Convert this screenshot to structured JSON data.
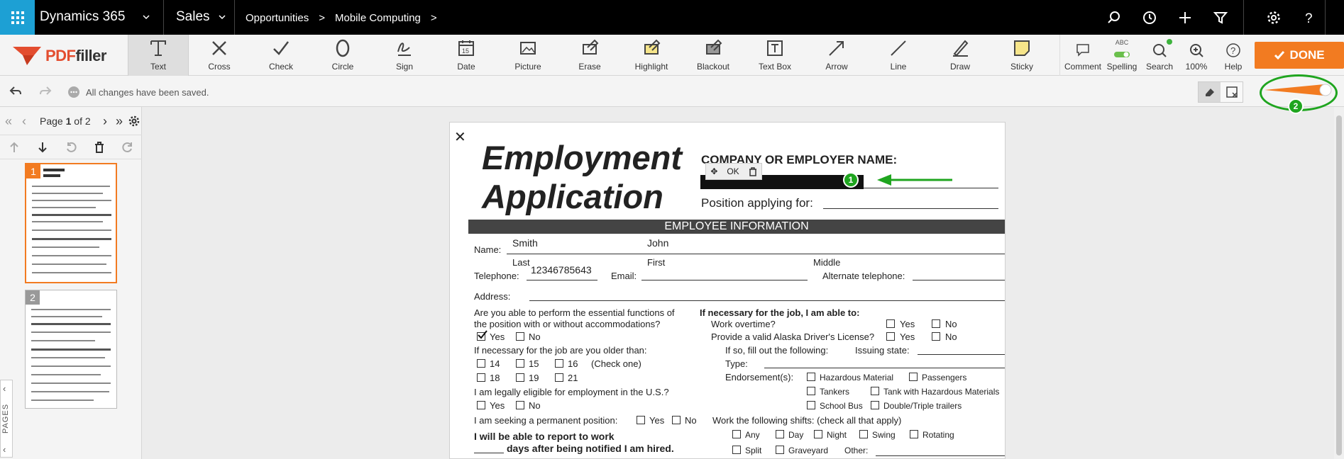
{
  "topbar": {
    "app_name": "Dynamics 365",
    "area": "Sales",
    "breadcrumb": [
      "Opportunities",
      "Mobile Computing"
    ]
  },
  "toolbar": {
    "logo_prefix": "PDF",
    "logo_suffix": "filler",
    "tools": [
      {
        "label": "Text",
        "icon": "text-icon"
      },
      {
        "label": "Cross",
        "icon": "cross-icon"
      },
      {
        "label": "Check",
        "icon": "check-icon"
      },
      {
        "label": "Circle",
        "icon": "circle-icon"
      },
      {
        "label": "Sign",
        "icon": "sign-icon"
      },
      {
        "label": "Date",
        "icon": "date-icon"
      },
      {
        "label": "Picture",
        "icon": "picture-icon"
      },
      {
        "label": "Erase",
        "icon": "erase-icon"
      },
      {
        "label": "Highlight",
        "icon": "highlight-icon"
      },
      {
        "label": "Blackout",
        "icon": "blackout-icon"
      },
      {
        "label": "Text Box",
        "icon": "textbox-icon"
      },
      {
        "label": "Arrow",
        "icon": "arrow-icon"
      },
      {
        "label": "Line",
        "icon": "line-icon"
      },
      {
        "label": "Draw",
        "icon": "draw-icon"
      },
      {
        "label": "Sticky",
        "icon": "sticky-icon"
      }
    ],
    "right_tools": [
      {
        "label": "Comment",
        "icon": "comment-icon"
      },
      {
        "label": "Spelling",
        "icon": "spelling-icon",
        "badge": "ABC"
      },
      {
        "label": "Search",
        "icon": "search-icon"
      },
      {
        "label": "100%",
        "icon": "zoom-icon"
      },
      {
        "label": "Help",
        "icon": "help-icon"
      }
    ],
    "done_label": "DONE",
    "accent": "#f27b21"
  },
  "status": {
    "saved_text": "All changes have been saved."
  },
  "pager": {
    "page_prefix": "Page",
    "current": "1",
    "of_label": "of 2",
    "thumbs": [
      "1",
      "2"
    ],
    "side_tab": "PAGES"
  },
  "annotations": {
    "badge1": "1",
    "badge2": "2",
    "color": "#1fa51f"
  },
  "document": {
    "title_line1": "Employment",
    "title_line2": "Application",
    "company_label": "COMPANY OR EMPLOYER NAME:",
    "ok_label": "OK",
    "position_label": "Position applying for:",
    "section_header": "EMPLOYEE INFORMATION",
    "name_label": "Name:",
    "last_name_value": "Smith",
    "first_name_value": "John",
    "last_caption": "Last",
    "first_caption": "First",
    "middle_caption": "Middle",
    "telephone_label": "Telephone:",
    "telephone_value": "12346785643",
    "email_label": "Email:",
    "alt_phone_label": "Alternate telephone:",
    "address_label": "Address:",
    "q_essential_1": "Are you able to perform the essential functions of",
    "q_essential_2": "the position with or without accommodations?",
    "yes": "Yes",
    "no": "No",
    "q_older": "If necessary for the job are you older than:",
    "ages": [
      "14",
      "15",
      "16",
      "18",
      "19",
      "21"
    ],
    "check_one": "(Check one)",
    "q_eligible": "I am legally eligible for employment in the U.S.?",
    "q_permanent": "I am seeking a permanent position:",
    "report_1": "I will be able to report to work",
    "report_2": "days after being notified I am hired.",
    "r_heading": "If necessary for the job, I am able to:",
    "r_overtime": "Work overtime?",
    "r_license": "Provide a valid Alaska Driver's License?",
    "r_ifso": "If so, fill out the following:",
    "r_issuing": "Issuing state:",
    "r_type": "Type:",
    "r_endorse": "Endorsement(s):",
    "endorsements": [
      "Hazardous Material",
      "Passengers",
      "Tankers",
      "Tank with Hazardous Materials",
      "School Bus",
      "Double/Triple trailers"
    ],
    "shifts_label": "Work the following shifts: (check all that apply)",
    "shifts": [
      "Any",
      "Day",
      "Night",
      "Swing",
      "Rotating",
      "Split",
      "Graveyard",
      "Other:"
    ]
  }
}
